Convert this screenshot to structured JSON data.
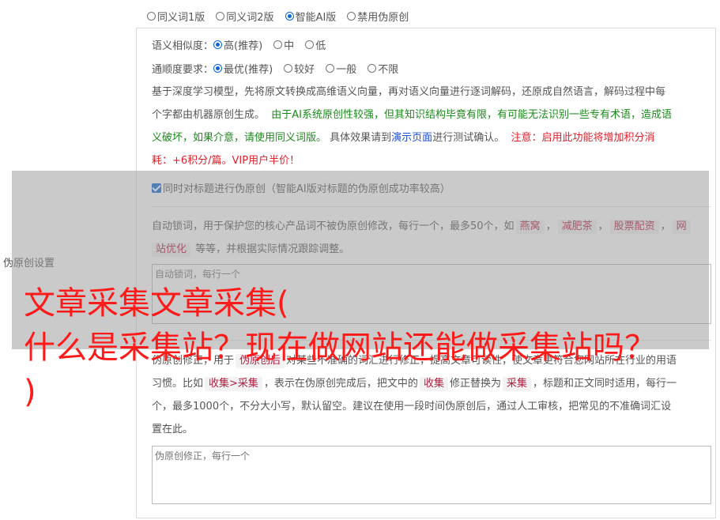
{
  "mode_options": [
    {
      "label": "同义词1版",
      "checked": false
    },
    {
      "label": "同义词2版",
      "checked": false
    },
    {
      "label": "智能AI版",
      "checked": true
    },
    {
      "label": "禁用伪原创",
      "checked": false
    }
  ],
  "similarity": {
    "label": "语义相似度：",
    "options": [
      {
        "label": "高(推荐)",
        "checked": true
      },
      {
        "label": "中",
        "checked": false
      },
      {
        "label": "低",
        "checked": false
      }
    ]
  },
  "fluency": {
    "label": "通顺度要求：",
    "options": [
      {
        "label": "最优(推荐)",
        "checked": true
      },
      {
        "label": "较好",
        "checked": false
      },
      {
        "label": "一般",
        "checked": false
      },
      {
        "label": "不限",
        "checked": false
      }
    ]
  },
  "description": {
    "part1": "基于深度学习模型，先将原文转换成高维语义向量，再对语义向量进行逐词解码，还原成自然语言，解码过程中每",
    "part2": "个字都由机器原创生成。",
    "green": "由于AI系统原创性较强，但其知识结构毕竟有限，有可能无法识别一些专有术语，造成语",
    "green2": "义破坏，如果介意，请使用同义词版。",
    "part3": "具体效果请到",
    "link": "演示页面",
    "part4": "进行测试确认。",
    "red1": "注意：启用此功能将增加积分消",
    "red2": "耗：+6积分/篇。VIP用户半价！"
  },
  "title_checkbox": {
    "label": "同时对标题进行伪原创（智能AI版对标题的伪原创成功率较高）",
    "checked": true
  },
  "side_label": "伪原创设置",
  "lock_words": {
    "text1": "自动锁词，用于保护您的核心产品词不被伪原创修改，每行一个，最多50个，如",
    "tags": [
      "燕窝",
      "减肥茶",
      "股票配资",
      "网"
    ],
    "tag_tail": "站优化",
    "text2": "等等，并根据实际情况跟踪调整。",
    "placeholder": "自动锁词，每行一个"
  },
  "correction": {
    "line1_a": "伪原创修正，用于",
    "line1_tag": "伪原创后",
    "line1_b": "对某些不准确的词汇进行修正，提高文章可读性，使文章更符合您网站所在行业的用语",
    "line2_a": "习惯。比如",
    "tag_from": "收集>采集",
    "line2_b": "，表示在伪原创完成后，把文中的",
    "tag_word": "收集",
    "line2_c": "修正替换为",
    "tag_to": "采集",
    "line2_d": "，标题和正文同时适用，每行一",
    "line3": "个，最多1000个，不分大小写，默认留空。建议在使用一段时间伪原创后，通过人工审核，把常见的不准确词汇设",
    "line4": "置在此。",
    "placeholder": "伪原创修正，每行一个"
  },
  "headline": {
    "line1": "文章采集文章采集(",
    "line2": "什么是采集站？现在做网站还能做采集站吗？",
    "line3": ")"
  }
}
